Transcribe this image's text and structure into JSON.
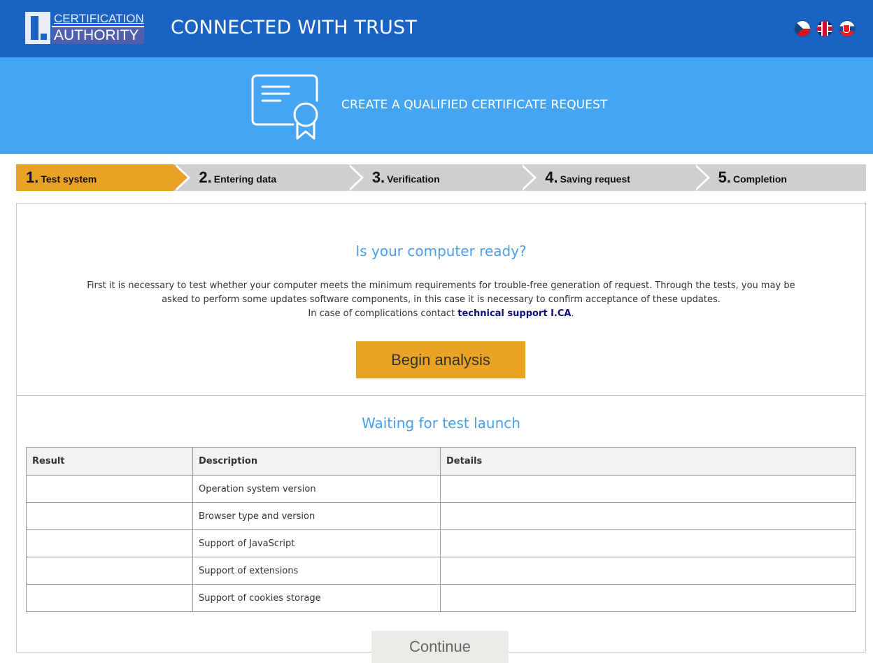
{
  "header": {
    "logo_line1": "CERTIFICATION",
    "logo_line2": "AUTHORITY",
    "slogan": "CONNECTED WITH TRUST",
    "flags": [
      "flag-cz-icon",
      "flag-gb-icon",
      "flag-sk-icon"
    ]
  },
  "banner": {
    "icon": "certificate-icon",
    "title": "CREATE A QUALIFIED CERTIFICATE REQUEST"
  },
  "steps": [
    {
      "num": "1.",
      "label": "Test system",
      "active": true
    },
    {
      "num": "2.",
      "label": "Entering data",
      "active": false
    },
    {
      "num": "3.",
      "label": "Verification",
      "active": false
    },
    {
      "num": "4.",
      "label": "Saving request",
      "active": false
    },
    {
      "num": "5.",
      "label": "Completion",
      "active": false
    }
  ],
  "intro": {
    "heading": "Is your computer ready?",
    "line1": "First it is necessary to test whether your computer meets the minimum requirements for trouble-free generation of request. Through the tests, you may be",
    "line2": "asked to perform some updates software components, in this case it is necessary to confirm acceptance of these updates.",
    "line3_prefix": "In case of complications contact",
    "support_link": "technical support I.CA",
    "line3_suffix": ".",
    "begin_button": "Begin analysis"
  },
  "tests": {
    "heading": "Waiting for test launch",
    "columns": [
      "Result",
      "Description",
      "Details"
    ],
    "rows": [
      {
        "result": "",
        "description": "Operation system version",
        "details": ""
      },
      {
        "result": "",
        "description": "Browser type and version",
        "details": ""
      },
      {
        "result": "",
        "description": "Support of JavaScript",
        "details": ""
      },
      {
        "result": "",
        "description": "Support of extensions",
        "details": ""
      },
      {
        "result": "",
        "description": "Support of cookies storage",
        "details": ""
      }
    ],
    "continue_button": "Continue"
  },
  "colors": {
    "header_blue": "#1a63c2",
    "banner_blue": "#45a5f2",
    "accent_orange": "#e9a324",
    "heading_blue": "#4a9ef0",
    "link_navy": "#10107a"
  }
}
